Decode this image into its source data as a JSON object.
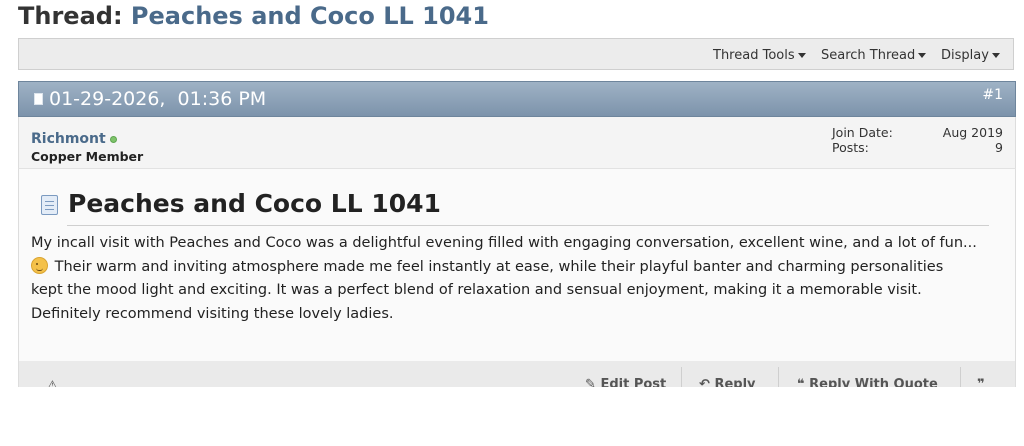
{
  "thread": {
    "prefix": "Thread:",
    "title": "Peaches and Coco LL 1041"
  },
  "toolbar": {
    "thread_tools": "Thread Tools",
    "search_thread": "Search Thread",
    "display": "Display"
  },
  "post": {
    "date_time": "01-29-2026,  01:36 PM",
    "number": "#1",
    "user": {
      "name": "Richmont",
      "title": "Copper Member",
      "join_date_label": "Join Date:",
      "join_date": "Aug 2019",
      "posts_label": "Posts:",
      "posts": "9"
    },
    "title": "Peaches and Coco LL 1041",
    "body": {
      "line1": "My incall visit with Peaches and Coco was a delightful evening filled with engaging conversation, excellent wine, and a lot of fun...",
      "line2_after_icon": "Their warm and inviting atmosphere made me feel instantly at ease, while their playful banter and charming personalities",
      "line3": "kept the mood light and exciting. It was a perfect blend of relaxation and sensual enjoyment, making it a memorable visit.",
      "line4": "Definitely recommend visiting these lovely ladies."
    },
    "footer": {
      "edit_post": "Edit Post",
      "reply": "Reply",
      "reply_with_quote": "Reply With Quote"
    }
  },
  "colors": {
    "link_blue": "#4a6a8a",
    "header_bar": "#8aa0b7",
    "online": "#7fc36b"
  }
}
